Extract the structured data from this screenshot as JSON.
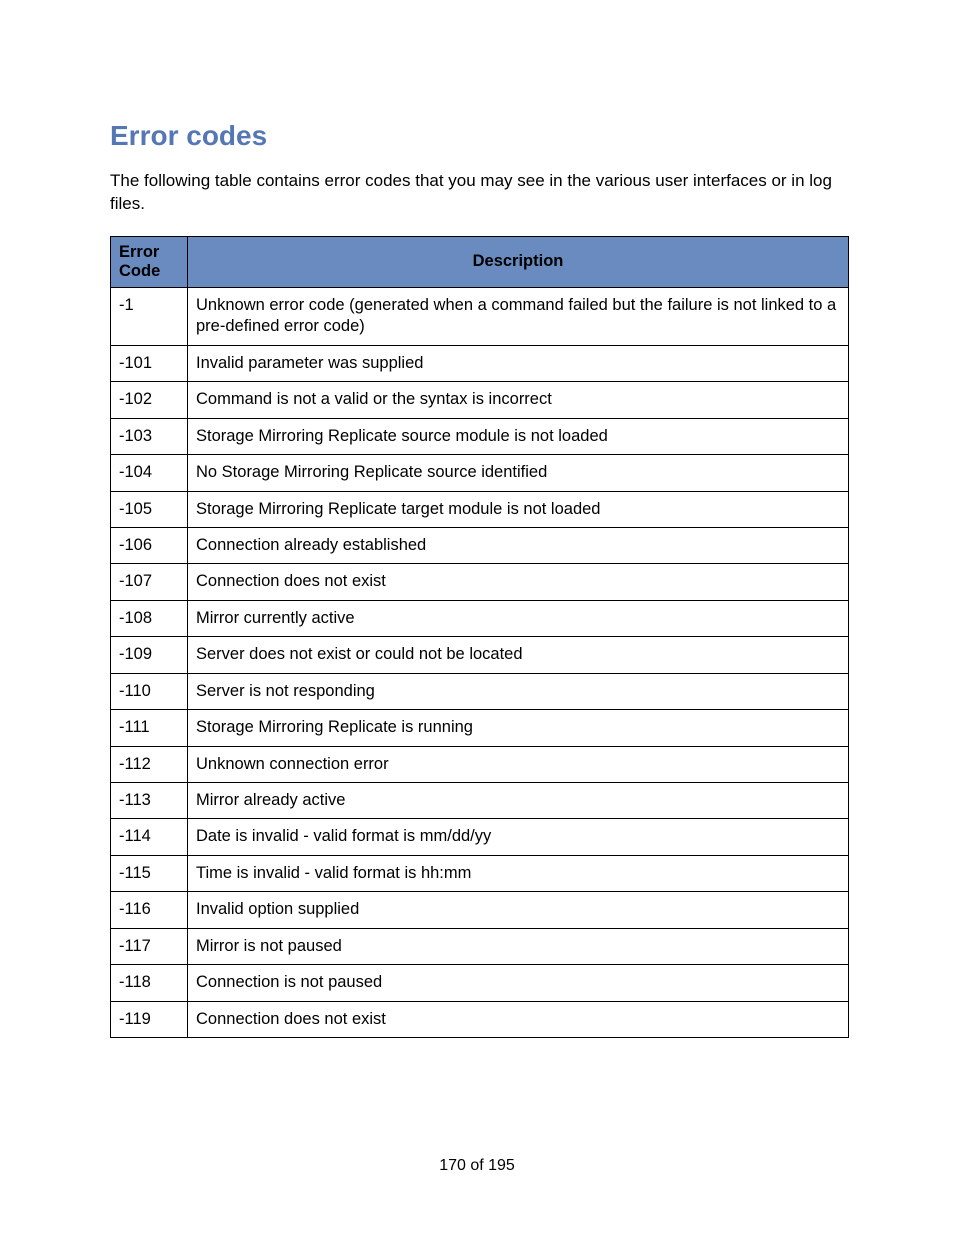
{
  "title": "Error codes",
  "intro": "The following table contains error codes that you may see in the various user interfaces or in log files.",
  "table": {
    "header_code": "Error Code",
    "header_desc": "Description",
    "rows": [
      {
        "code": "-1",
        "desc": "Unknown error code (generated when a command failed but the failure is not linked to a pre-defined error code)"
      },
      {
        "code": "-101",
        "desc": "Invalid parameter was supplied"
      },
      {
        "code": "-102",
        "desc": "Command is not a valid or the syntax is incorrect"
      },
      {
        "code": "-103",
        "desc": "Storage Mirroring Replicate source module is not loaded"
      },
      {
        "code": "-104",
        "desc": "No Storage Mirroring Replicate source identified"
      },
      {
        "code": "-105",
        "desc": "Storage Mirroring Replicate target module is not loaded"
      },
      {
        "code": "-106",
        "desc": "Connection already established"
      },
      {
        "code": "-107",
        "desc": "Connection does not exist"
      },
      {
        "code": "-108",
        "desc": "Mirror currently active"
      },
      {
        "code": "-109",
        "desc": "Server does not exist or could not be located"
      },
      {
        "code": "-110",
        "desc": "Server is not responding"
      },
      {
        "code": "-111",
        "desc": "Storage Mirroring Replicate is running"
      },
      {
        "code": "-112",
        "desc": "Unknown connection error"
      },
      {
        "code": "-113",
        "desc": "Mirror already active"
      },
      {
        "code": "-114",
        "desc": "Date is invalid - valid format is mm/dd/yy"
      },
      {
        "code": "-115",
        "desc": "Time is invalid - valid format is hh:mm"
      },
      {
        "code": "-116",
        "desc": "Invalid option supplied"
      },
      {
        "code": "-117",
        "desc": "Mirror is not paused"
      },
      {
        "code": "-118",
        "desc": "Connection is not paused"
      },
      {
        "code": "-119",
        "desc": "Connection does not exist"
      }
    ]
  },
  "footer": "170 of 195"
}
